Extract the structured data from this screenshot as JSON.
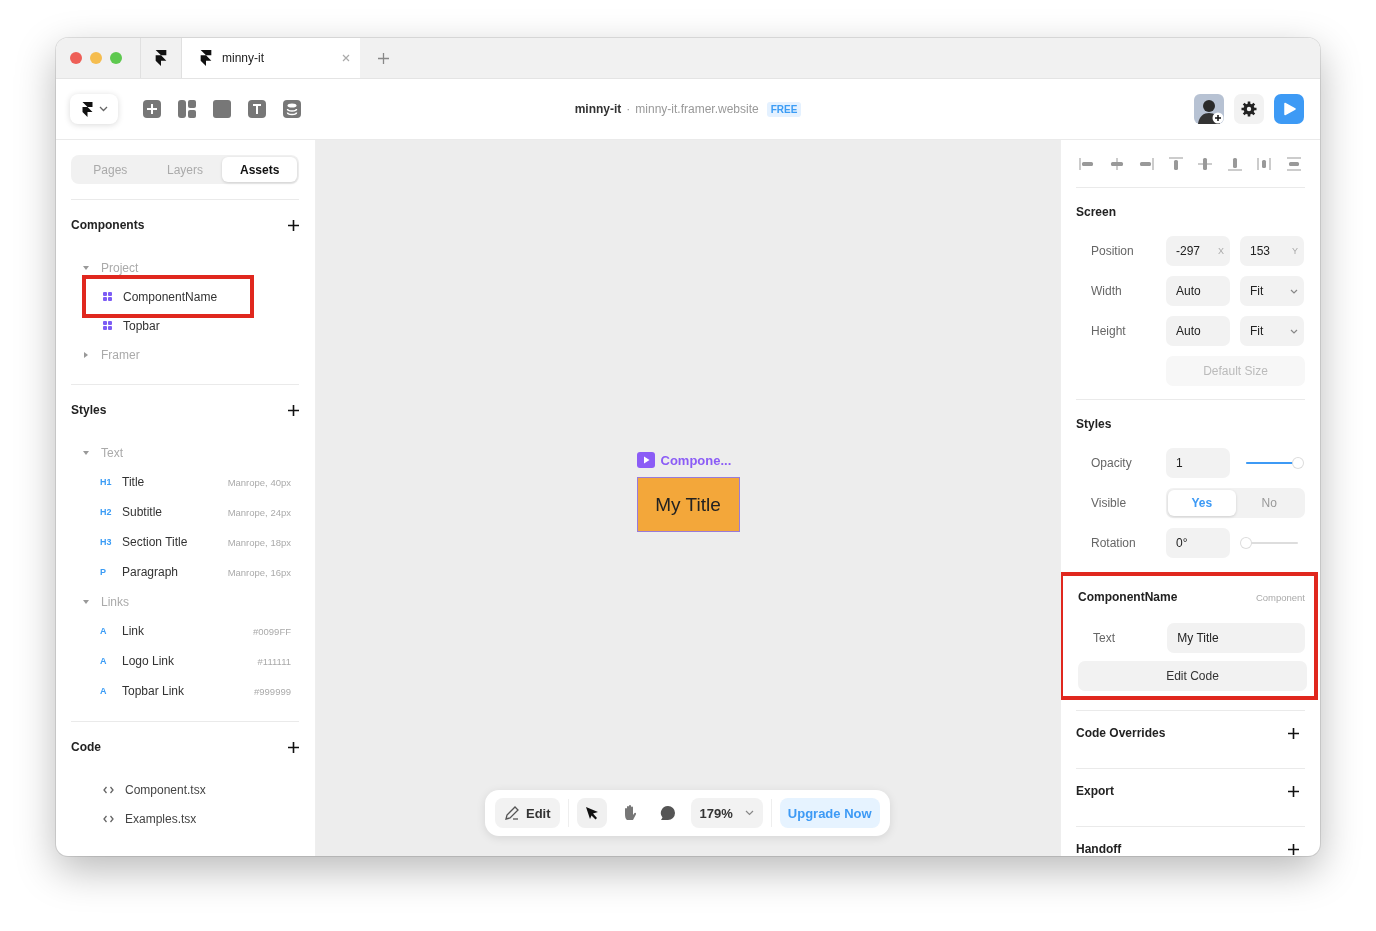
{
  "browser": {
    "tabs": [
      {
        "label": "minny-it",
        "selected": true
      }
    ]
  },
  "toolbar": {
    "project": "minny-it",
    "separator": "·",
    "domain": "minny-it.framer.website",
    "plan": "FREE"
  },
  "panel_tabs": [
    {
      "label": "Pages",
      "selected": false
    },
    {
      "label": "Layers",
      "selected": false
    },
    {
      "label": "Assets",
      "selected": true
    }
  ],
  "components": {
    "title": "Components",
    "groups": [
      {
        "label": "Project",
        "expanded": true,
        "children": [
          {
            "label": "ComponentName",
            "highlighted": true
          },
          {
            "label": "Topbar",
            "highlighted": false
          }
        ]
      },
      {
        "label": "Framer",
        "expanded": false
      }
    ]
  },
  "styles": {
    "title": "Styles",
    "groups": [
      {
        "label": "Text",
        "expanded": true,
        "children": [
          {
            "tag": "H1",
            "label": "Title",
            "detail": "Manrope, 40px"
          },
          {
            "tag": "H2",
            "label": "Subtitle",
            "detail": "Manrope, 24px"
          },
          {
            "tag": "H3",
            "label": "Section Title",
            "detail": "Manrope, 18px"
          },
          {
            "tag": "P",
            "label": "Paragraph",
            "detail": "Manrope, 16px"
          }
        ]
      },
      {
        "label": "Links",
        "expanded": true,
        "children": [
          {
            "tag": "A",
            "label": "Link",
            "detail": "#0099FF"
          },
          {
            "tag": "A",
            "label": "Logo Link",
            "detail": "#111111"
          },
          {
            "tag": "A",
            "label": "Topbar Link",
            "detail": "#999999"
          }
        ]
      }
    ]
  },
  "code": {
    "title": "Code",
    "files": [
      "Component.tsx",
      "Examples.tsx"
    ]
  },
  "canvas": {
    "frame_label": "Compone...",
    "frame_text": "My Title"
  },
  "bottom_bar": {
    "edit": "Edit",
    "tools": [
      {
        "kind": "pointer",
        "selected": true
      },
      {
        "kind": "hand",
        "selected": false
      },
      {
        "kind": "comment",
        "selected": false
      }
    ],
    "zoom": "179%",
    "upgrade": "Upgrade Now"
  },
  "screen": {
    "title": "Screen",
    "rows": [
      {
        "label": "Position",
        "fields": [
          {
            "value": "-297",
            "suffix": "X"
          },
          {
            "value": "153",
            "suffix": "Y"
          }
        ]
      },
      {
        "label": "Width",
        "fields": [
          {
            "value": "Auto"
          },
          {
            "value": "Fit",
            "dropdown": true
          }
        ]
      },
      {
        "label": "Height",
        "fields": [
          {
            "value": "Auto"
          },
          {
            "value": "Fit",
            "dropdown": true
          }
        ]
      }
    ],
    "default_size": {
      "label": "Default Size",
      "disabled": true
    }
  },
  "style_props": {
    "title": "Styles",
    "opacity": {
      "label": "Opacity",
      "value": "1",
      "level": 1
    },
    "visible": {
      "label": "Visible",
      "options": [
        {
          "label": "Yes",
          "selected": true
        },
        {
          "label": "No",
          "selected": false
        }
      ]
    },
    "rotation": {
      "label": "Rotation",
      "value": "0°",
      "level": 0
    }
  },
  "component": {
    "title": "ComponentName",
    "tag": "Component",
    "highlighted": true,
    "text_label": "Text",
    "text_value": "My Title",
    "button": "Edit Code"
  },
  "sections": [
    "Code Overrides",
    "Export",
    "Handoff"
  ]
}
